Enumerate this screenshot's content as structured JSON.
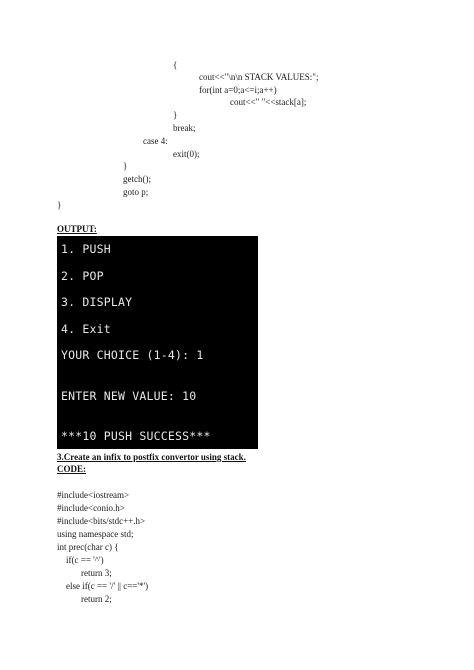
{
  "top_code": [
    "{",
    "cout<<\"\\n\\n STACK VALUES:\";",
    "for(int a=0;a<=i;a++)",
    "cout<<\" \"<<stack[a];",
    "}",
    "break;",
    "case 4:",
    "exit(0);",
    "}",
    "getch();",
    "goto p;",
    "}"
  ],
  "output_heading": "OUTPUT:",
  "console_lines": [
    "1. PUSH",
    "2. POP",
    "3. DISPLAY",
    "4. Exit",
    "YOUR CHOICE (1-4): 1",
    "ENTER NEW VALUE: 10",
    "***10 PUSH SUCCESS***"
  ],
  "section_title": "3.Create an infix to postfix convertor using stack.",
  "code_heading": "CODE:",
  "bottom_code": [
    "#include<iostream>",
    "#include<conio.h>",
    "#include<bits/stdc++.h>",
    "using namespace std;",
    "int prec(char c) {",
    "if(c == '^')",
    "return 3;",
    "else if(c == '/' || c=='*')",
    "return 2;"
  ]
}
